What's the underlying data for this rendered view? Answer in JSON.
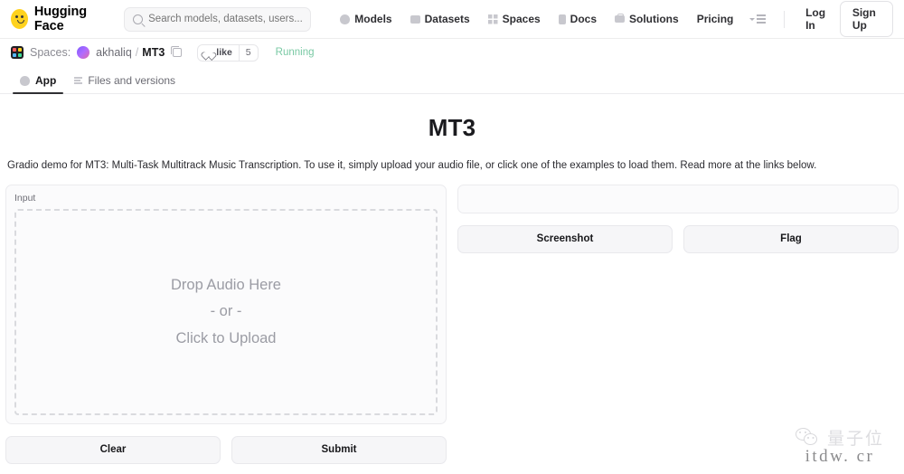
{
  "header": {
    "brand": "Hugging Face",
    "brand_logo_icon": "huggingface-emoji-logo",
    "search": {
      "placeholder": "Search models, datasets, users...",
      "value": "",
      "icon": "search-icon"
    },
    "nav_links": [
      {
        "label": "Models",
        "icon": "models-icon"
      },
      {
        "label": "Datasets",
        "icon": "datasets-icon"
      },
      {
        "label": "Spaces",
        "icon": "spaces-icon"
      },
      {
        "label": "Docs",
        "icon": "docs-icon"
      },
      {
        "label": "Solutions",
        "icon": "solutions-icon"
      }
    ],
    "pricing_label": "Pricing",
    "menu_icon": "hamburger-menu-icon",
    "login_label": "Log In",
    "signup_label": "Sign Up"
  },
  "breadcrumb": {
    "spaces_icon": "spaces-grid-icon",
    "spaces_label": "Spaces:",
    "avatar_icon": "user-avatar",
    "owner": "akhaliq",
    "separator": "/",
    "repo": "MT3",
    "copy_icon": "copy-icon",
    "like_label": "like",
    "like_icon": "heart-icon",
    "like_count": "5",
    "status": "Running",
    "status_color": "#79c9a4"
  },
  "tabs": [
    {
      "label": "App",
      "icon": "app-icon",
      "active": true
    },
    {
      "label": "Files and versions",
      "icon": "files-icon",
      "active": false
    }
  ],
  "app": {
    "title": "MT3",
    "description": "Gradio demo for MT3: Multi-Task Multitrack Music Transcription. To use it, simply upload your audio file, or click one of the examples to load them. Read more at the links below.",
    "input": {
      "label": "Input",
      "dropzone_line1": "Drop Audio Here",
      "dropzone_line2": "- or -",
      "dropzone_line3": "Click to Upload"
    },
    "buttons": {
      "clear": "Clear",
      "submit": "Submit",
      "screenshot": "Screenshot",
      "flag": "Flag"
    },
    "output": {
      "value": ""
    }
  },
  "watermark": {
    "chat_icon": "wechat-icon",
    "cn_text": "量子位",
    "url_text": "itdw. cr"
  }
}
